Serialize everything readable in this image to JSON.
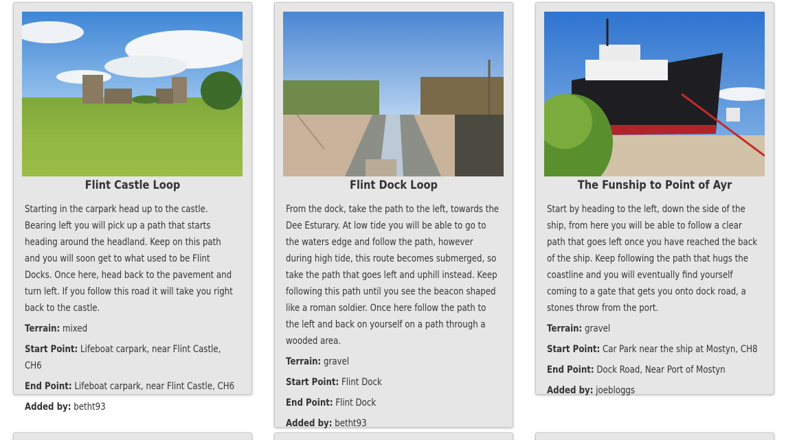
{
  "walks": [
    {
      "title": "Flint Castle Loop",
      "description": "Starting in the carpark head up to the castle. Bearing left you will pick up a path that starts heading around the headland. Keep on this path and you will soon get to what used to be Flint Docks. Once here, head back to the pavement and turn left. If you follow this road it will take you right back to the castle.",
      "terrain_label": "Terrain:",
      "terrain": "mixed",
      "start_label": "Start Point:",
      "start": "Lifeboat carpark, near Flint Castle, CH6",
      "end_label": "End Point:",
      "end": "Lifeboat carpark, near Flint Castle, CH6",
      "added_label": "Added by:",
      "added_by": "betht93"
    },
    {
      "title": "Flint Dock Loop",
      "description": "From the dock, take the path to the left, towards the Dee Esturary. At low tide you will be able to go to the waters edge and follow the path, however during high tide, this route becomes submerged, so take the path that goes left and uphill instead. Keep following this path until you see the beacon shaped like a roman soldier. Once here follow the path to the left and back on yourself on a path through a wooded area.",
      "terrain_label": "Terrain:",
      "terrain": "gravel",
      "start_label": "Start Point:",
      "start": "Flint Dock",
      "end_label": "End Point:",
      "end": "Flint Dock",
      "added_label": "Added by:",
      "added_by": "betht93"
    },
    {
      "title": "The Funship to Point of Ayr",
      "description": "Start by heading to the left, down the side of the ship, from here you will be able to follow a clear path that goes left once you have reached the back of the ship. Keep following the path that hugs the coastline and you will eventually find yourself coming to a gate that gets you onto dock road, a stones throw from the port.",
      "terrain_label": "Terrain:",
      "terrain": "gravel",
      "start_label": "Start Point:",
      "start": "Car Park near the ship at Mostyn, CH8",
      "end_label": "End Point:",
      "end": "Dock Road, Near Port of Mostyn",
      "added_label": "Added by:",
      "added_by": "joebloggs"
    }
  ]
}
